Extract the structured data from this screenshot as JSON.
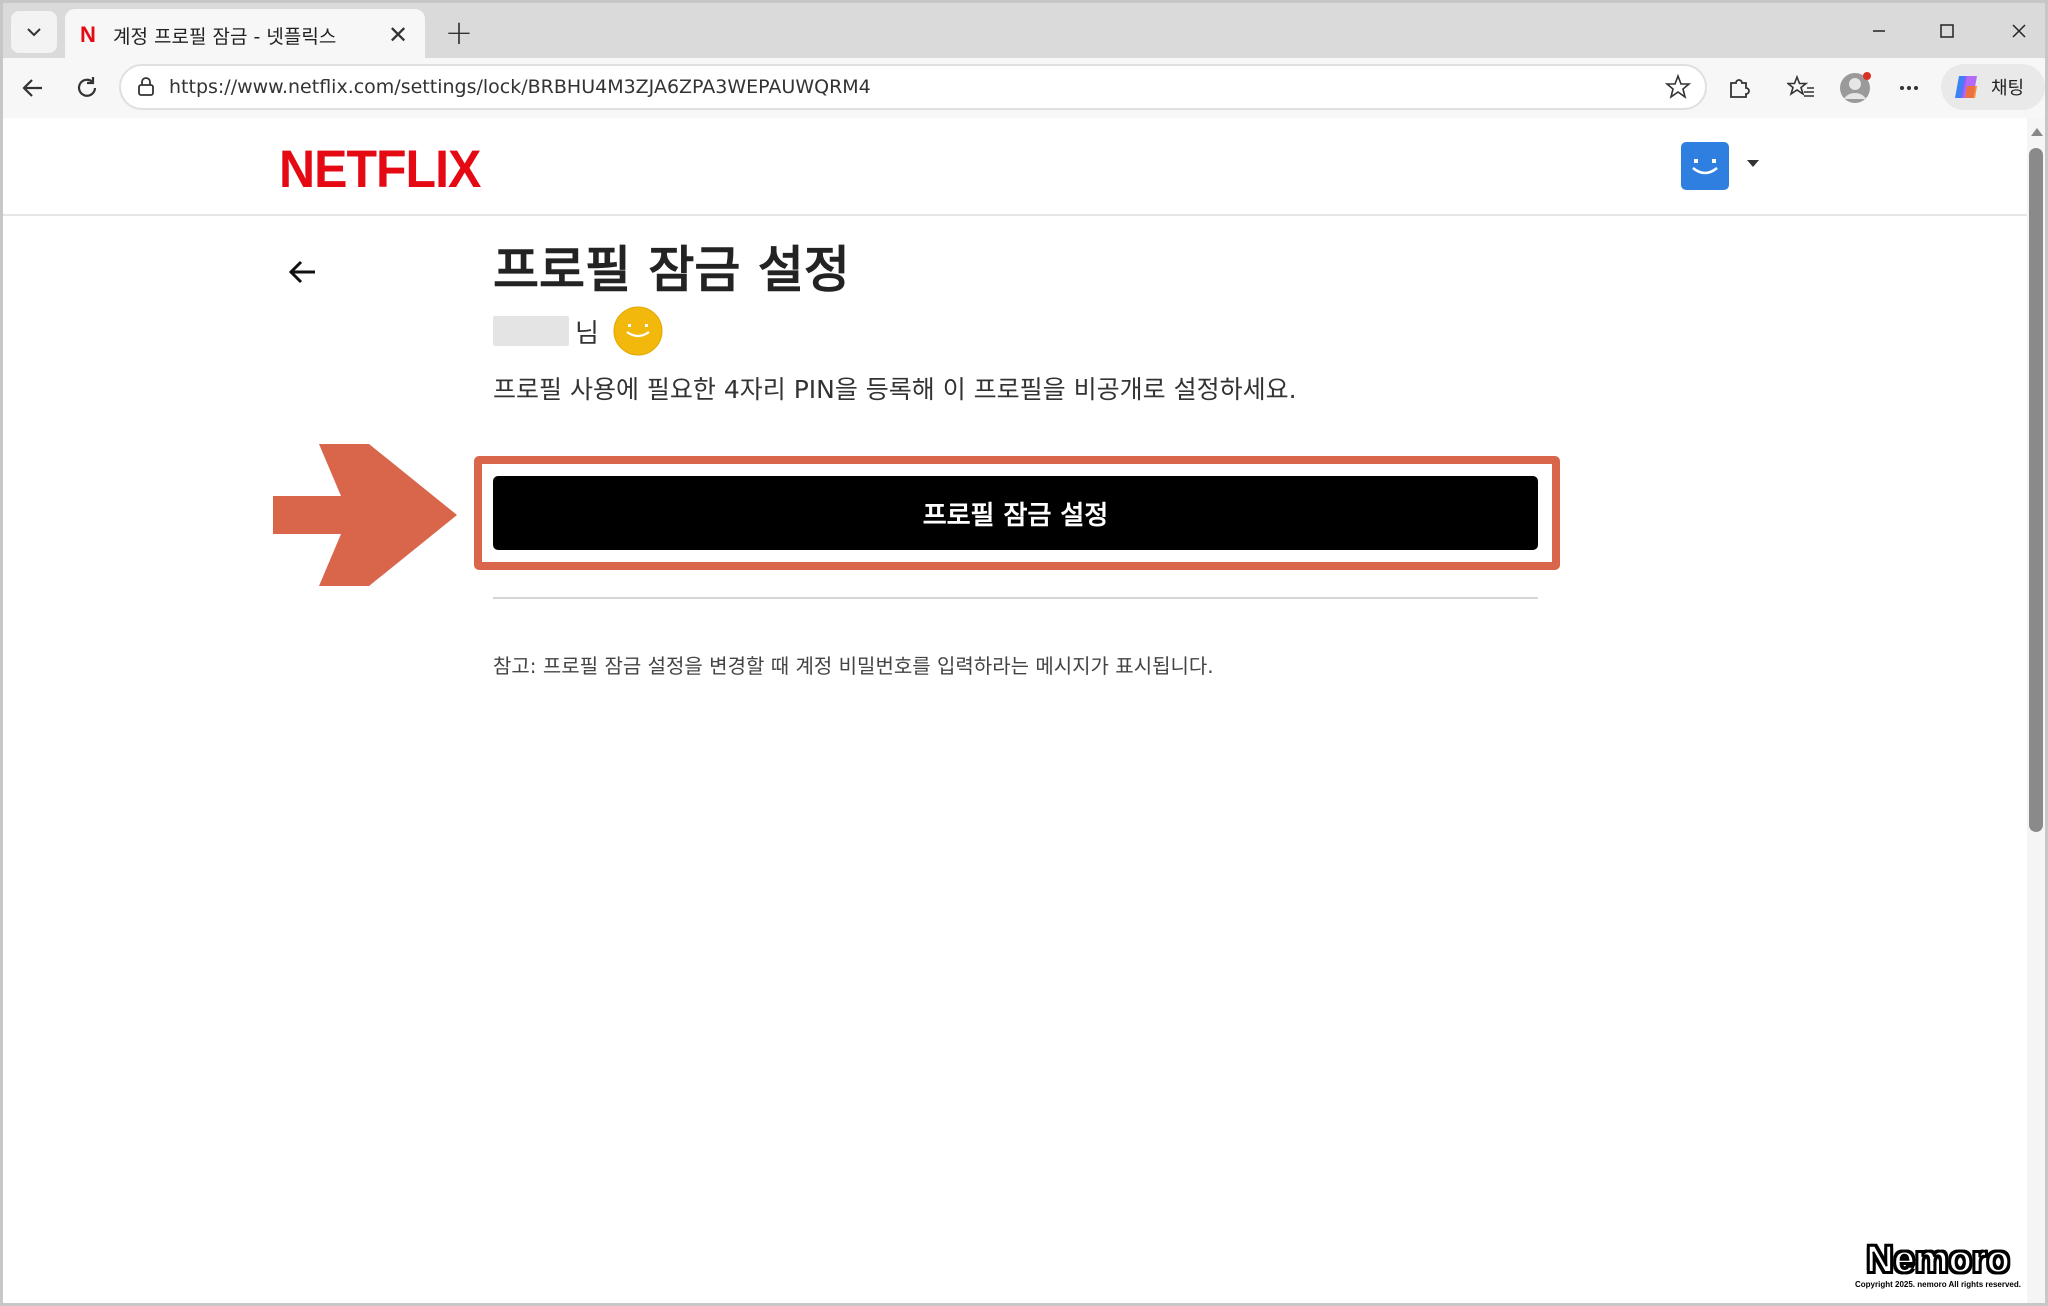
{
  "browser": {
    "tab": {
      "title": "계정 프로필 잠금 - 넷플릭스",
      "favicon": "N"
    },
    "url": "https://www.netflix.com/settings/lock/BRBHU4M3ZJA6ZPA3WEPAUWQRM4",
    "copilot_label": "채팅"
  },
  "site": {
    "logo": "NETFLIX",
    "brand_color": "#e50914",
    "avatar_color": "#2f7fe0"
  },
  "page": {
    "title": "프로필 잠금 설정",
    "honorific": "님",
    "description": "프로필 사용에 필요한 4자리 PIN을 등록해 이 프로필을 비공개로 설정하세요.",
    "primary_button": "프로필 잠금 설정",
    "note": "참고: 프로필 잠금 설정을 변경할 때 계정 비밀번호를 입력하라는 메시지가 표시됩니다.",
    "highlight_color": "#d9664a"
  },
  "watermark": {
    "main": "Nemoro",
    "sub": "Copyright 2025. nemoro All rights reserved."
  }
}
